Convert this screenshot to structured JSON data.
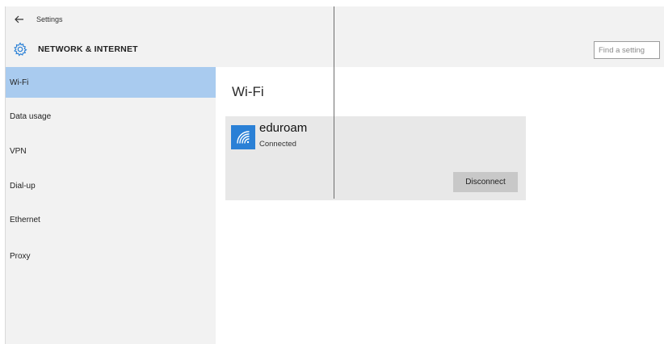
{
  "window": {
    "app_title": "Settings"
  },
  "header": {
    "section_title": "NETWORK & INTERNET",
    "search": {
      "placeholder": "Find a setting"
    }
  },
  "sidebar": {
    "items": [
      {
        "label": "Wi-Fi",
        "selected": true
      },
      {
        "label": "Data usage",
        "selected": false
      },
      {
        "label": "VPN",
        "selected": false
      },
      {
        "label": "Dial-up",
        "selected": false
      },
      {
        "label": "Ethernet",
        "selected": false
      },
      {
        "label": "Proxy",
        "selected": false
      }
    ]
  },
  "main": {
    "heading": "Wi-Fi",
    "network": {
      "ssid": "eduroam",
      "status": "Connected",
      "disconnect_label": "Disconnect"
    }
  },
  "icons": {
    "back": "back-arrow-icon",
    "section": "gear-icon",
    "network": "wifi-icon"
  },
  "colors": {
    "accent": "#2a80d6",
    "selection": "#a9cbef",
    "chrome": "#f2f2f2",
    "card": "#e8e8e8",
    "button": "#c8c8c8"
  }
}
